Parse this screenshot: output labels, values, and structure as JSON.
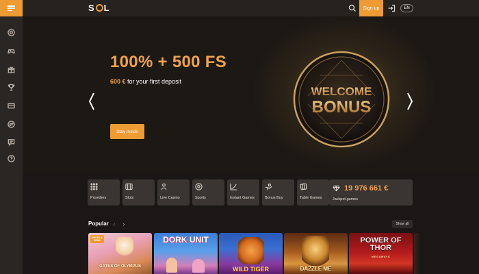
{
  "sidebar": {
    "menu_icon": "hamburger-icon",
    "items": [
      {
        "icon": "football-icon"
      },
      {
        "icon": "gamepad-icon"
      },
      {
        "icon": "gift-icon"
      },
      {
        "icon": "trophy-icon"
      },
      {
        "icon": "card-icon"
      },
      {
        "icon": "swap-icon"
      },
      {
        "icon": "chat-icon"
      },
      {
        "icon": "help-icon"
      }
    ]
  },
  "header": {
    "logo": "SOL",
    "signup_label": "Sign up",
    "lang_label": "EN"
  },
  "hero": {
    "title": "100% + 500 FS",
    "amount": "600 €",
    "subtitle_rest": " for your first deposit",
    "cta_label": "Stay inside",
    "badge_line1": "WELCOME",
    "badge_line2": "BONUS"
  },
  "categories": [
    {
      "label": "Providers",
      "icon": "grid-dots-icon"
    },
    {
      "label": "Slots",
      "icon": "slot-icon"
    },
    {
      "label": "Live Casino",
      "icon": "dealer-icon"
    },
    {
      "label": "Sports",
      "icon": "ball-icon"
    },
    {
      "label": "Instant Games",
      "icon": "chart-icon"
    },
    {
      "label": "Bonus Buy",
      "icon": "hand-icon"
    },
    {
      "label": "Table Games",
      "icon": "cards-icon"
    }
  ],
  "jackpot": {
    "amount": "19 976 661 €",
    "label": "Jackpot games"
  },
  "popular": {
    "title": "Popular",
    "show_all": "Show all",
    "prev": "‹",
    "next": "›",
    "games": [
      {
        "title": "GATES OF OLYMPUS",
        "badge": "DROPS & WINS"
      },
      {
        "title": "DORK UNIT"
      },
      {
        "title": "WILD TIGER"
      },
      {
        "title": "DAZZLE ME"
      },
      {
        "title": "POWER OF THOR",
        "sub": "MEGAWAYS"
      }
    ]
  },
  "colors": {
    "accent": "#ef9b34",
    "background": "#1a1716",
    "card": "#3a3532"
  }
}
